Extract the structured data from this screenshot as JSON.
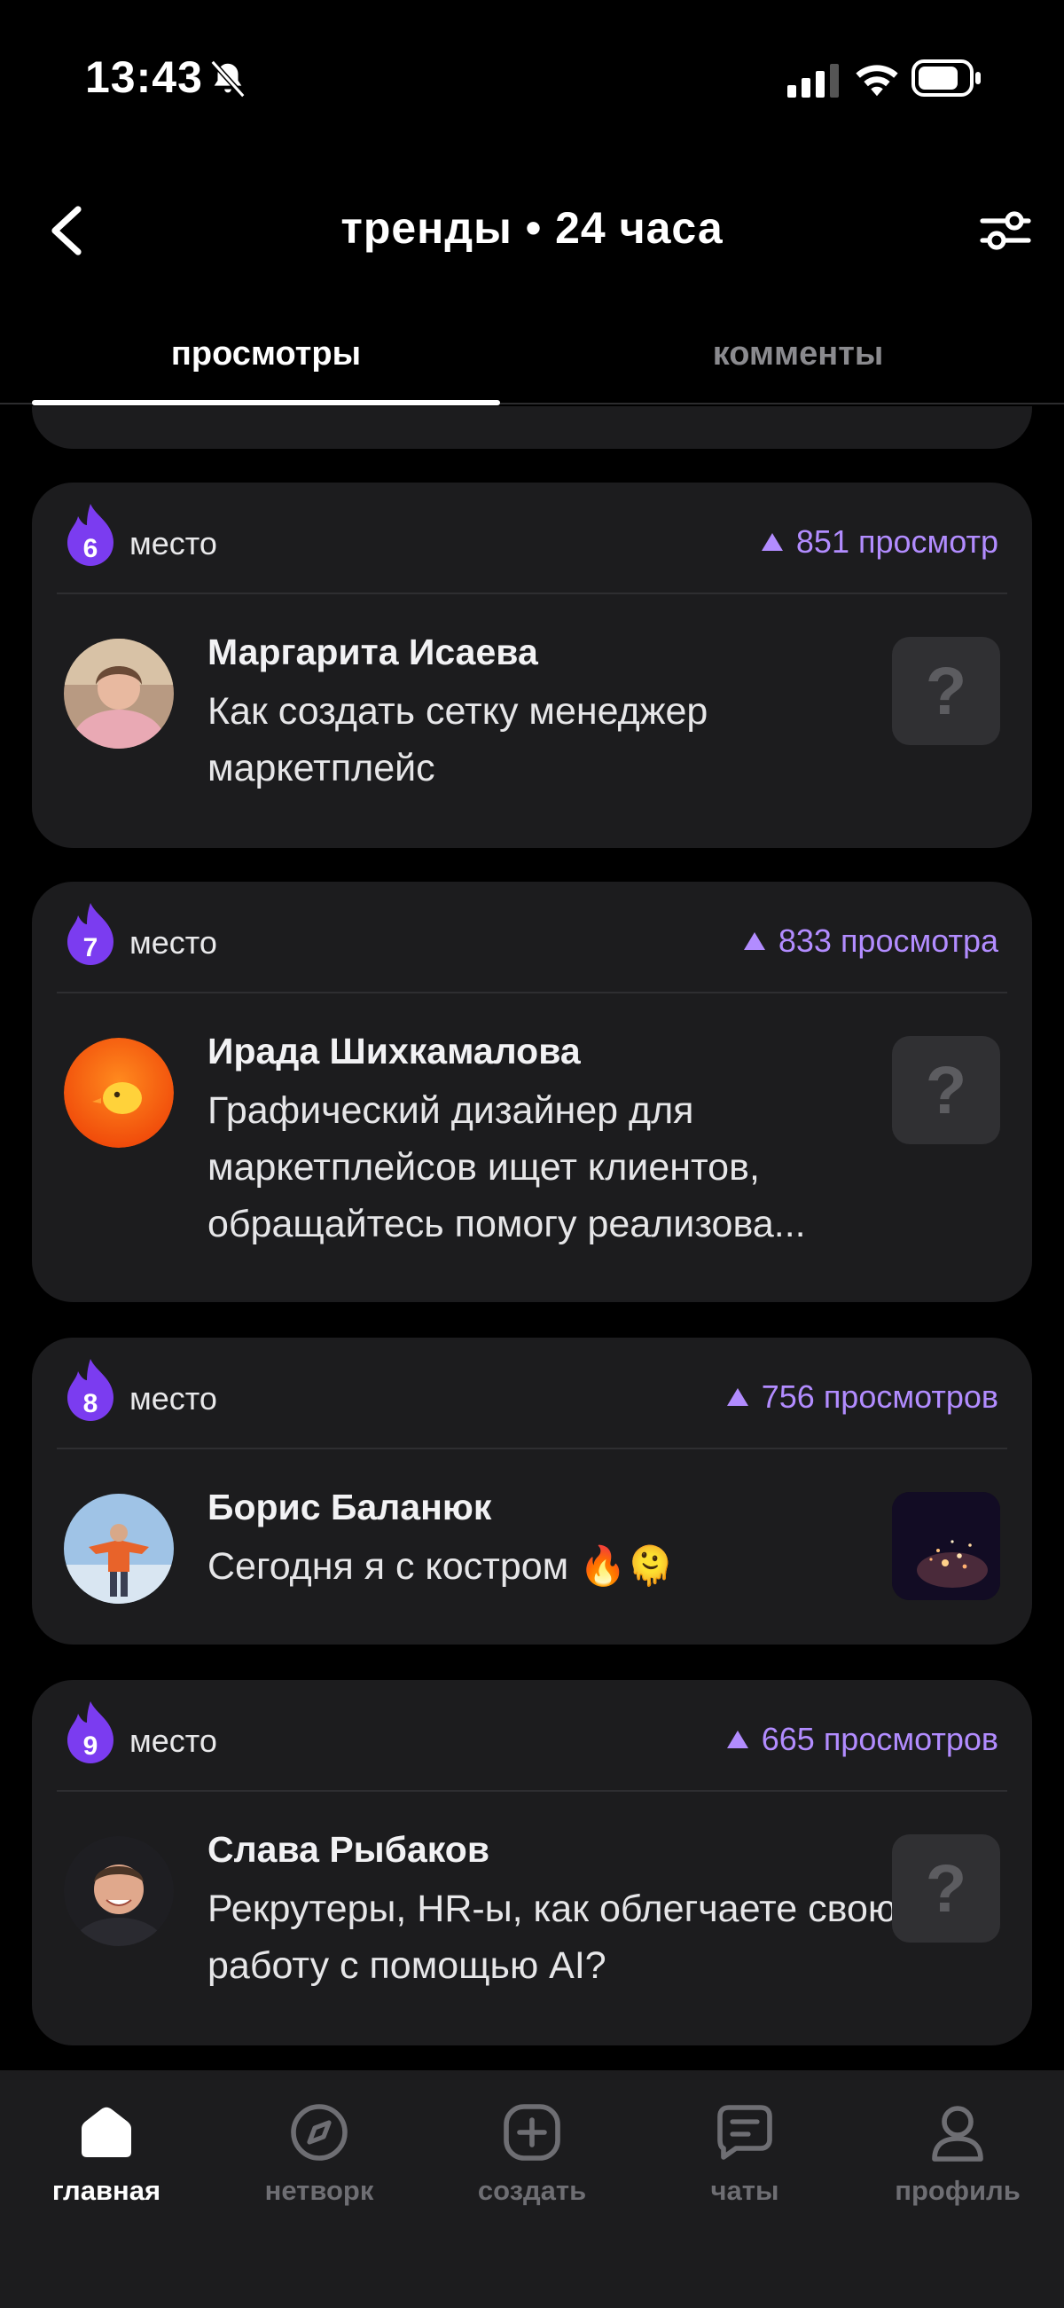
{
  "status_bar": {
    "time": "13:43"
  },
  "header": {
    "title": "тренды • 24 часа"
  },
  "tabs": [
    {
      "label": "просмотры",
      "active": true
    },
    {
      "label": "комменты",
      "active": false
    }
  ],
  "cards": [
    {
      "rank": "6",
      "rank_label": "место",
      "views": "851 просмотр",
      "author": "Маргарита Исаева",
      "text": "Как создать сетку менеджер маркетплейс",
      "thumb": "placeholder"
    },
    {
      "rank": "7",
      "rank_label": "место",
      "views": "833 просмотра",
      "author": "Ирада Шихкамалова",
      "text": "Графический дизайнер для маркетплейсов ищет клиентов, обращайтесь помогу реализова...",
      "thumb": "placeholder"
    },
    {
      "rank": "8",
      "rank_label": "место",
      "views": "756 просмотров",
      "author": "Борис Баланюк",
      "text": "Сегодня я с костром 🔥🫠",
      "thumb": "photo"
    },
    {
      "rank": "9",
      "rank_label": "место",
      "views": "665 просмотров",
      "author": "Слава Рыбаков",
      "text": "Рекрутеры, HR-ы, как облегчаете свою работу с помощью AI?",
      "thumb": "placeholder"
    }
  ],
  "placeholder_glyph": "?",
  "bottom_nav": [
    {
      "label": "главная",
      "icon": "home-icon",
      "active": true
    },
    {
      "label": "нетворк",
      "icon": "compass-icon",
      "active": false
    },
    {
      "label": "создать",
      "icon": "plus-square-icon",
      "active": false
    },
    {
      "label": "чаты",
      "icon": "chat-icon",
      "active": false
    },
    {
      "label": "профиль",
      "icon": "profile-icon",
      "active": false
    }
  ],
  "colors": {
    "accent": "#b28cff",
    "rank_badge": "#7b3cf0",
    "card_bg": "#1c1c1e",
    "background": "#000000"
  }
}
